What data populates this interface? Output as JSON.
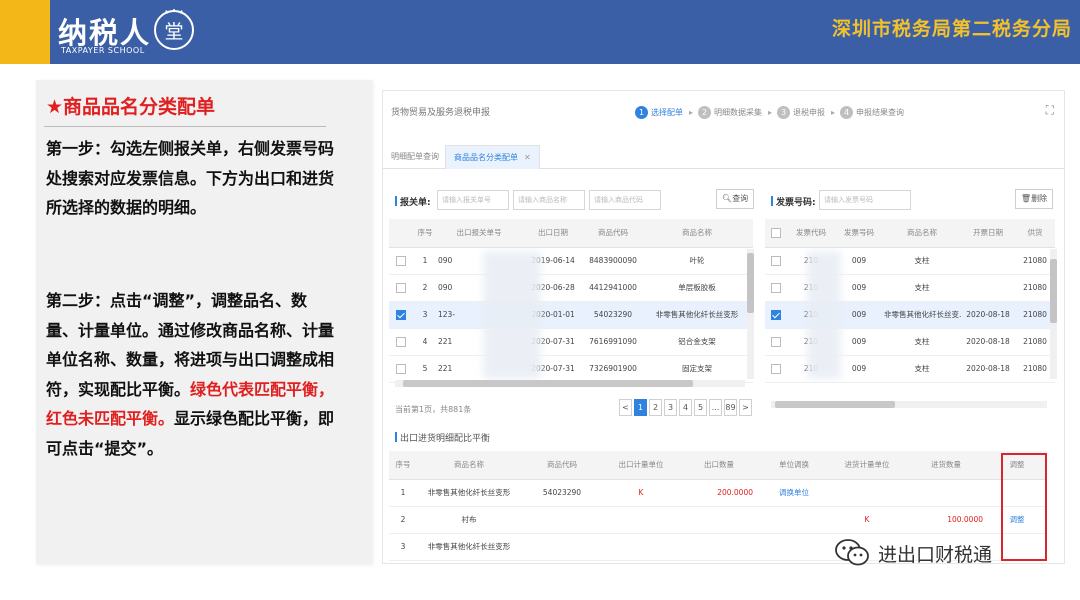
{
  "header": {
    "logo_text": "纳税人",
    "logo_sub": "TAXPAYER SCHOOL",
    "logo_seal_char": "堂",
    "bureau": "深圳市税务局第二税务分局",
    "colors": {
      "bar": "#3a5fa6",
      "accent": "#f3b818",
      "bureau_text": "#f3c12b"
    }
  },
  "left": {
    "title": "★商品品名分类配单",
    "step1": "第一步：勾选左侧报关单，右侧发票号码处搜索对应发票信息。下方为出口和进货所选择的数据的明细。",
    "step2_a": "第二步：点击“调整”，调整品名、数量、计量单位。通过修改商品名称、计量单位名称、数量，将进项与出口调整成相符，实现配比平衡。",
    "step2_green": "绿色代表匹配平衡，",
    "step2_red": "红色未匹配平衡。",
    "step2_b": "显示绿色配比平衡，即可点击“提交”。"
  },
  "window": {
    "title": "货物贸易及服务退税申报",
    "steps": [
      {
        "n": "1",
        "label": "选择配单",
        "active": true
      },
      {
        "n": "2",
        "label": "明细数据采集",
        "active": false
      },
      {
        "n": "3",
        "label": "退税申报",
        "active": false
      },
      {
        "n": "4",
        "label": "申报结果查询",
        "active": false
      }
    ],
    "tabs": {
      "tab1": "明细配单查询",
      "tab2": "商品品名分类配单"
    },
    "customs": {
      "label": "报关单:",
      "placeholders": [
        "请输入报关单号",
        "请输入商品名称",
        "请输入商品代码"
      ],
      "query_btn": "查询",
      "headers": [
        "",
        "序号",
        "出口报关单号",
        "出口日期",
        "商品代码",
        "商品名称"
      ],
      "rows": [
        {
          "checked": false,
          "no": "1",
          "decl": "090",
          "date": "2019-06-14",
          "code": "8483900090",
          "name": "叶轮"
        },
        {
          "checked": false,
          "no": "2",
          "decl": "090",
          "date": "2020-06-28",
          "code": "4412941000",
          "name": "单层板胶板"
        },
        {
          "checked": true,
          "no": "3",
          "decl": "123-",
          "date": "2020-01-01",
          "code": "54023290",
          "name": "非零售其他化纤长丝变形"
        },
        {
          "checked": false,
          "no": "4",
          "decl": "221",
          "date": "2020-07-31",
          "code": "7616991090",
          "name": "铝合金支架"
        },
        {
          "checked": false,
          "no": "5",
          "decl": "221",
          "date": "2020-07-31",
          "code": "7326901900",
          "name": "固定支架"
        }
      ],
      "page_info": "当前第1页，共881条",
      "pages": [
        "<",
        "1",
        "2",
        "3",
        "4",
        "5",
        "...",
        "89",
        ">"
      ]
    },
    "invoice": {
      "label": "发票号码:",
      "placeholder": "请输入发票号码",
      "delete_btn": "删除",
      "headers": [
        "",
        "发票代码",
        "发票号码",
        "商品名称",
        "开票日期",
        "供货"
      ],
      "rows": [
        {
          "checked": false,
          "code": "210",
          "no": "009",
          "name": "支柱",
          "date": "",
          "seller": "21080"
        },
        {
          "checked": false,
          "code": "210",
          "no": "009",
          "name": "支柱",
          "date": "",
          "seller": "21080"
        },
        {
          "checked": true,
          "code": "210",
          "no": "009",
          "name": "非零售其他化纤长丝变...",
          "date": "2020-08-18",
          "seller": "21080"
        },
        {
          "checked": false,
          "code": "210",
          "no": "009",
          "name": "支柱",
          "date": "2020-08-18",
          "seller": "21080"
        },
        {
          "checked": false,
          "code": "210",
          "no": "009",
          "name": "支柱",
          "date": "2020-08-18",
          "seller": "21080"
        }
      ]
    },
    "detail": {
      "label": "出口进货明细配比平衡",
      "headers": [
        "序号",
        "商品名称",
        "商品代码",
        "出口计量单位",
        "出口数量",
        "单位调换",
        "进货计量单位",
        "进货数量",
        "调整"
      ],
      "rows": [
        {
          "no": "1",
          "name": "非零售其他化纤长丝变形",
          "code": "54023290",
          "unit": "K",
          "qty": "200.0000",
          "swap": "调换单位",
          "in_unit": "",
          "in_qty": "",
          "adjust": ""
        },
        {
          "no": "2",
          "name": "衬布",
          "code": "",
          "unit": "",
          "qty": "",
          "swap": "",
          "in_unit": "K",
          "in_qty": "100.0000",
          "adjust": "调整"
        },
        {
          "no": "3",
          "name": "非零售其他化纤长丝变形",
          "code": "",
          "unit": "",
          "qty": "",
          "swap": "",
          "in_unit": "",
          "in_qty": "",
          "adjust": ""
        }
      ]
    }
  },
  "watermark": {
    "text": "进出口财税通"
  }
}
